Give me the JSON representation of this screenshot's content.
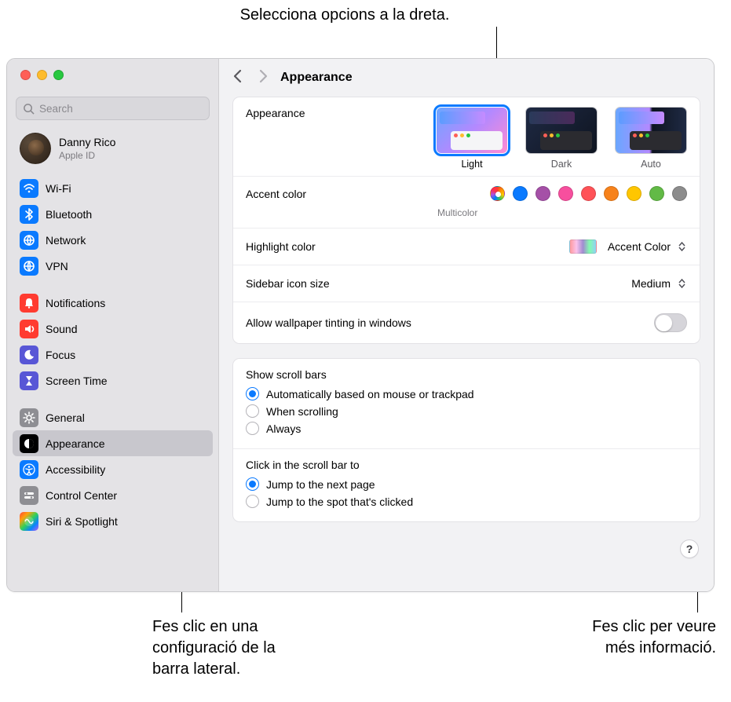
{
  "callouts": {
    "top": "Selecciona opcions a la dreta.",
    "bottom_left": "Fes clic en una\nconfiguració de la\nbarra lateral.",
    "bottom_right": "Fes clic per veure\nmés informació."
  },
  "search": {
    "placeholder": "Search"
  },
  "user": {
    "name": "Danny Rico",
    "sub": "Apple ID"
  },
  "sidebar": {
    "groups": [
      [
        {
          "label": "Wi-Fi",
          "icon": "wifi",
          "color": "ic-blue"
        },
        {
          "label": "Bluetooth",
          "icon": "bluetooth",
          "color": "ic-blue"
        },
        {
          "label": "Network",
          "icon": "network",
          "color": "ic-blue"
        },
        {
          "label": "VPN",
          "icon": "vpn",
          "color": "ic-blue"
        }
      ],
      [
        {
          "label": "Notifications",
          "icon": "bell",
          "color": "ic-red"
        },
        {
          "label": "Sound",
          "icon": "sound",
          "color": "ic-red"
        },
        {
          "label": "Focus",
          "icon": "moon",
          "color": "ic-purple"
        },
        {
          "label": "Screen Time",
          "icon": "hourglass",
          "color": "ic-purple"
        }
      ],
      [
        {
          "label": "General",
          "icon": "gear",
          "color": "ic-gray"
        },
        {
          "label": "Appearance",
          "icon": "appearance",
          "color": "ic-black",
          "selected": true
        },
        {
          "label": "Accessibility",
          "icon": "accessibility",
          "color": "ic-blue"
        },
        {
          "label": "Control Center",
          "icon": "controlcenter",
          "color": "ic-gray"
        },
        {
          "label": "Siri & Spotlight",
          "icon": "siri",
          "color": "ic-multi"
        }
      ]
    ]
  },
  "page": {
    "title": "Appearance"
  },
  "appearance": {
    "label": "Appearance",
    "themes": [
      {
        "label": "Light",
        "selected": true
      },
      {
        "label": "Dark",
        "selected": false
      },
      {
        "label": "Auto",
        "selected": false
      }
    ]
  },
  "accent": {
    "label": "Accent color",
    "caption": "Multicolor",
    "colors": [
      {
        "name": "multicolor",
        "css": "conic-gradient(#ff3b30,#ff9500,#ffcc00,#34c759,#007aff,#af52de,#ff2d55,#ff3b30)",
        "selected": true
      },
      {
        "name": "blue",
        "css": "#0a7aff"
      },
      {
        "name": "purple",
        "css": "#a550a7"
      },
      {
        "name": "pink",
        "css": "#f74f9e"
      },
      {
        "name": "red",
        "css": "#ff5257"
      },
      {
        "name": "orange",
        "css": "#f7821b"
      },
      {
        "name": "yellow",
        "css": "#ffc600"
      },
      {
        "name": "green",
        "css": "#62ba46"
      },
      {
        "name": "graphite",
        "css": "#8c8c8c"
      }
    ]
  },
  "highlight": {
    "label": "Highlight color",
    "value": "Accent Color"
  },
  "sidebar_size": {
    "label": "Sidebar icon size",
    "value": "Medium"
  },
  "tinting": {
    "label": "Allow wallpaper tinting in windows",
    "on": false
  },
  "scrollbars": {
    "label": "Show scroll bars",
    "options": [
      {
        "label": "Automatically based on mouse or trackpad",
        "checked": true
      },
      {
        "label": "When scrolling",
        "checked": false
      },
      {
        "label": "Always",
        "checked": false
      }
    ]
  },
  "scrollclick": {
    "label": "Click in the scroll bar to",
    "options": [
      {
        "label": "Jump to the next page",
        "checked": true
      },
      {
        "label": "Jump to the spot that's clicked",
        "checked": false
      }
    ]
  },
  "help_glyph": "?"
}
